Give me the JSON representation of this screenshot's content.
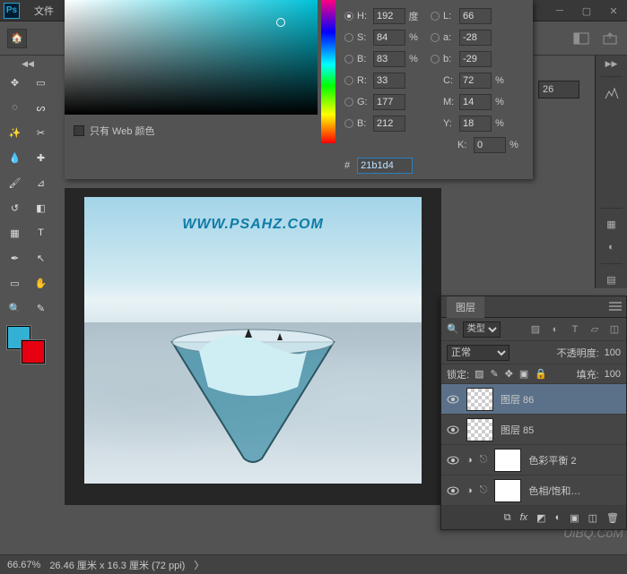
{
  "menu": {
    "file": "文件"
  },
  "color_picker": {
    "web_only_label": "只有 Web 颜色",
    "rows": {
      "H": {
        "label": "H:",
        "value": "192",
        "unit": "度"
      },
      "S": {
        "label": "S:",
        "value": "84",
        "unit": "%"
      },
      "B": {
        "label": "B:",
        "value": "83",
        "unit": "%"
      },
      "R": {
        "label": "R:",
        "value": "33",
        "unit": ""
      },
      "G": {
        "label": "G:",
        "value": "177",
        "unit": ""
      },
      "Bb": {
        "label": "B:",
        "value": "212",
        "unit": ""
      },
      "L": {
        "label": "L:",
        "value": "66",
        "unit": ""
      },
      "a": {
        "label": "a:",
        "value": "-28",
        "unit": ""
      },
      "b": {
        "label": "b:",
        "value": "-29",
        "unit": ""
      },
      "C": {
        "label": "C:",
        "value": "72",
        "unit": "%"
      },
      "M": {
        "label": "M:",
        "value": "14",
        "unit": "%"
      },
      "Y": {
        "label": "Y:",
        "value": "18",
        "unit": "%"
      },
      "K": {
        "label": "K:",
        "value": "0",
        "unit": "%"
      }
    },
    "hex_label": "#",
    "hex_value": "21b1d4",
    "foreground": "#33b1d4",
    "background": "#e60012"
  },
  "canvas": {
    "watermark": "WWW.PSAHZ.COM",
    "uibq": "UiBQ.CoM"
  },
  "opt_extra_value": "26",
  "layers_panel": {
    "tab": "图层",
    "type_label": "类型",
    "blend_mode": "正常",
    "opacity_label": "不透明度:",
    "opacity_value": "100",
    "lock_label": "锁定:",
    "fill_label": "填充:",
    "fill_value": "100",
    "layers": [
      {
        "name": "图层 86",
        "selected": true,
        "thumb": "transparent"
      },
      {
        "name": "图层 85",
        "selected": false,
        "thumb": "transparent"
      },
      {
        "name": "色彩平衡 2",
        "selected": false,
        "thumb": "white",
        "adj": true
      },
      {
        "name": "色相/饱和…",
        "selected": false,
        "thumb": "white",
        "adj": true
      }
    ],
    "search_icon": "🔍"
  },
  "status": {
    "zoom": "66.67%",
    "dims": "26.46 厘米 x 16.3 厘米 (72 ppi)",
    "arrow": "〉"
  }
}
